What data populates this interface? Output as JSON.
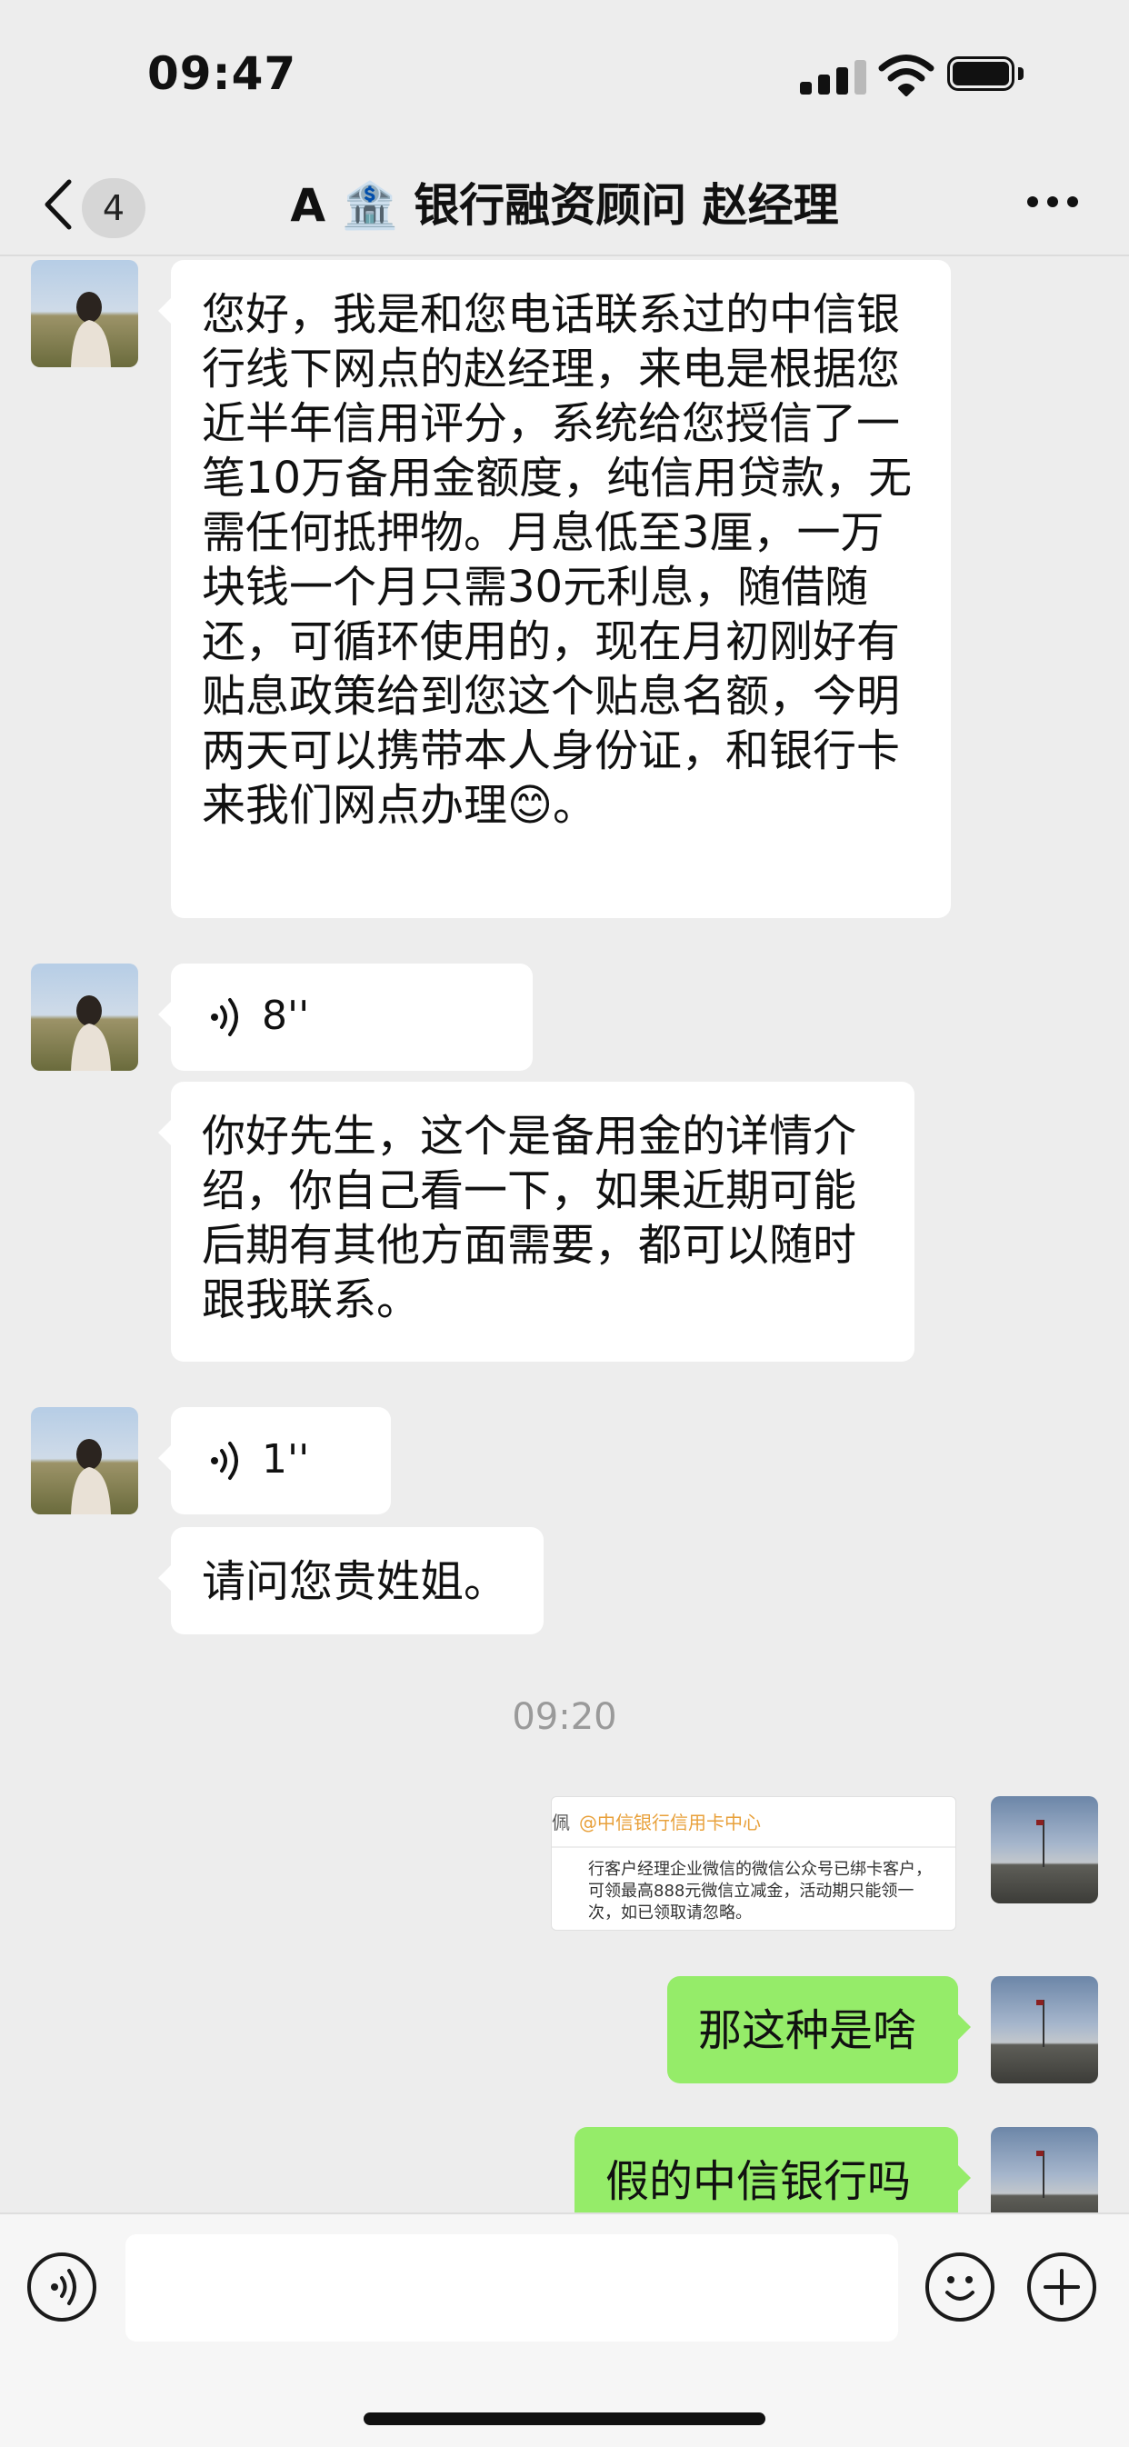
{
  "status_bar": {
    "time": "09:47"
  },
  "nav": {
    "back_count": "4",
    "title": "A 🏦 银行融资顾问 赵经理"
  },
  "messages": {
    "m1": "您好，我是和您电话联系过的中信银行线下网点的赵经理，来电是根据您近半年信用评分，系统给您授信了一笔10万备用金额度，纯信用贷款，无需任何抵押物。月息低至3厘，一万块钱一个月只需30元利息，随借随还，可循环使用的，现在月初刚好有贴息政策给到您这个贴息名额，今明两天可以携带本人身份证，和银行卡来我们网点办理😊。",
    "voice1": "8''",
    "m2": "你好先生，这个是备用金的详情介绍，你自己看一下，如果近期可能后期有其他方面需要，都可以随时跟我联系。",
    "voice2": "1''",
    "m3": "请问您贵姓姐。",
    "timestamp": "09:20",
    "image_card": {
      "edge_char": "佩",
      "source": "@中信银行信用卡中心",
      "text": "行客户经理企业微信的微信公众号已绑卡客户，可领最高888元微信立减金，活动期只能领一次，如已领取请忽略。"
    },
    "m4": "那这种是啥",
    "m5": "假的中信银行吗"
  },
  "icons": {
    "back": "chevron-left-icon",
    "more": "more-dots-icon",
    "voice_mode": "voice-icon",
    "emoji": "emoji-icon",
    "plus": "plus-icon"
  },
  "colors": {
    "background": "#ededed",
    "incoming_bubble": "#ffffff",
    "outgoing_bubble": "#95ec69"
  }
}
